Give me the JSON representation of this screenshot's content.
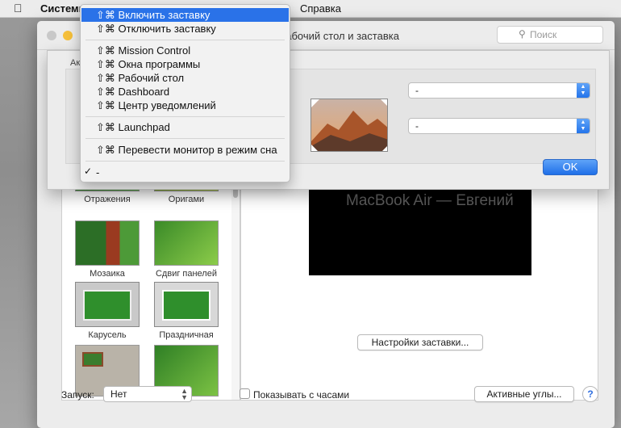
{
  "menubar": {
    "app_menu": "Системные настройки",
    "help_menu": "Справка"
  },
  "window": {
    "title": "Рабочий стол и заставка",
    "search_placeholder": "Поиск"
  },
  "screensavers": [
    {
      "label": "Отражения"
    },
    {
      "label": "Оригами"
    },
    {
      "label": "Мозаика"
    },
    {
      "label": "Сдвиг панелей"
    },
    {
      "label": "Карусель"
    },
    {
      "label": "Праздничная"
    },
    {
      "label": ""
    },
    {
      "label": ""
    }
  ],
  "preview": {
    "caption": "MacBook Air — Евгений",
    "settings_button": "Настройки заставки..."
  },
  "footer": {
    "start_label": "Запуск:",
    "start_value": "Нет",
    "clock_checkbox_label": "Показывать с часами",
    "hot_corners_button": "Активные углы...",
    "help_button": "?"
  },
  "sheet": {
    "label": "Ак",
    "top_right_value": "-",
    "bottom_right_value": "-",
    "ok_button": "OK"
  },
  "popup_menu": {
    "items": [
      {
        "label": "⇧⌘ Включить заставку",
        "highlighted": true
      },
      {
        "label": "⇧⌘ Отключить заставку"
      },
      {
        "label": "⇧⌘ Mission Control"
      },
      {
        "label": "⇧⌘ Окна программы"
      },
      {
        "label": "⇧⌘ Рабочий стол"
      },
      {
        "label": "⇧⌘ Dashboard"
      },
      {
        "label": "⇧⌘ Центр уведомлений"
      },
      {
        "label": "⇧⌘ Launchpad"
      },
      {
        "label": "⇧⌘ Перевести монитор в режим сна"
      },
      {
        "label": "-",
        "checked": true
      }
    ]
  },
  "colors": {
    "accent_blue": "#2a72e8",
    "window_bg": "#ececec"
  }
}
